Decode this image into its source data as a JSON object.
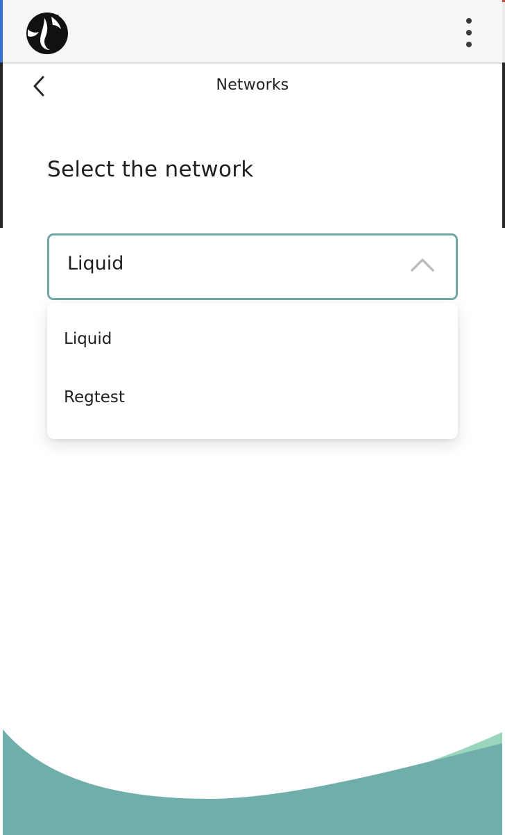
{
  "header": {
    "title": "Networks"
  },
  "main": {
    "section_title": "Select the network",
    "select": {
      "value": "Liquid",
      "options": [
        "Liquid",
        "Regtest"
      ]
    }
  },
  "colors": {
    "accent_border": "#6fa8a4",
    "wave_dark": "#6faeaa",
    "wave_light": "#9ad6bb"
  },
  "icons": {
    "logo": "mermaid-logo-icon",
    "menu": "more-vertical-icon",
    "back": "chevron-left-icon",
    "select": "chevron-up-icon"
  }
}
